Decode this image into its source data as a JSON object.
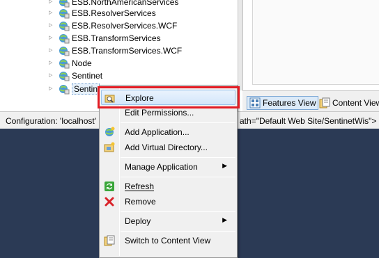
{
  "tree": {
    "items": [
      {
        "label": "ESB.NorthAmericanServices"
      },
      {
        "label": "ESB.ResolverServices"
      },
      {
        "label": "ESB.ResolverServices.WCF"
      },
      {
        "label": "ESB.TransformServices"
      },
      {
        "label": "ESB.TransformServices.WCF"
      },
      {
        "label": "Node"
      },
      {
        "label": "Sentinet"
      },
      {
        "label": "Sentin"
      }
    ]
  },
  "tabs": {
    "features_view": "Features View",
    "content_view": "Content View"
  },
  "status": {
    "left": "Configuration: 'localhost'",
    "right": "ath=\"Default Web Site/SentinetWis\">"
  },
  "menu": {
    "items": [
      {
        "label": "Explore"
      },
      {
        "label": "Edit Permissions..."
      },
      {
        "label": "Add Application..."
      },
      {
        "label": "Add Virtual Directory..."
      },
      {
        "label": "Manage Application"
      },
      {
        "label": "Refresh"
      },
      {
        "label": "Remove"
      },
      {
        "label": "Deploy"
      },
      {
        "label": "Switch to Content View"
      }
    ]
  },
  "colors": {
    "highlight_box": "#e21b23",
    "desktop": "#2b3a55"
  }
}
